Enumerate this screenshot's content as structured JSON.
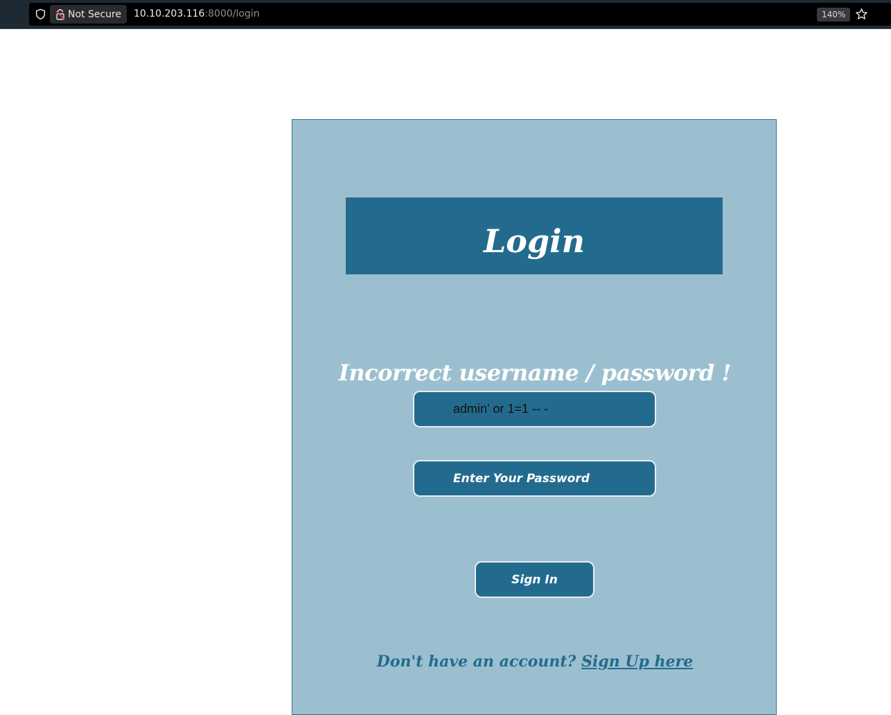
{
  "browser": {
    "security_label": "Not Secure",
    "url_host": "10.10.203.116",
    "url_rest": ":8000/login",
    "zoom": "140%",
    "icons": [
      "shield-icon",
      "broken-lock-icon",
      "star-icon"
    ]
  },
  "login": {
    "title": "Login",
    "error_message": "Incorrect username / password !",
    "username_value": "admin' or 1=1 -- -",
    "password_placeholder": "Enter Your Password",
    "submit_label": "Sign In",
    "signup_prompt": "Don't have an account? ",
    "signup_link": "Sign Up here"
  },
  "colors": {
    "card_bg": "#9bbfcf",
    "accent": "#236b8e",
    "chrome_bg": "#1e2a33"
  }
}
